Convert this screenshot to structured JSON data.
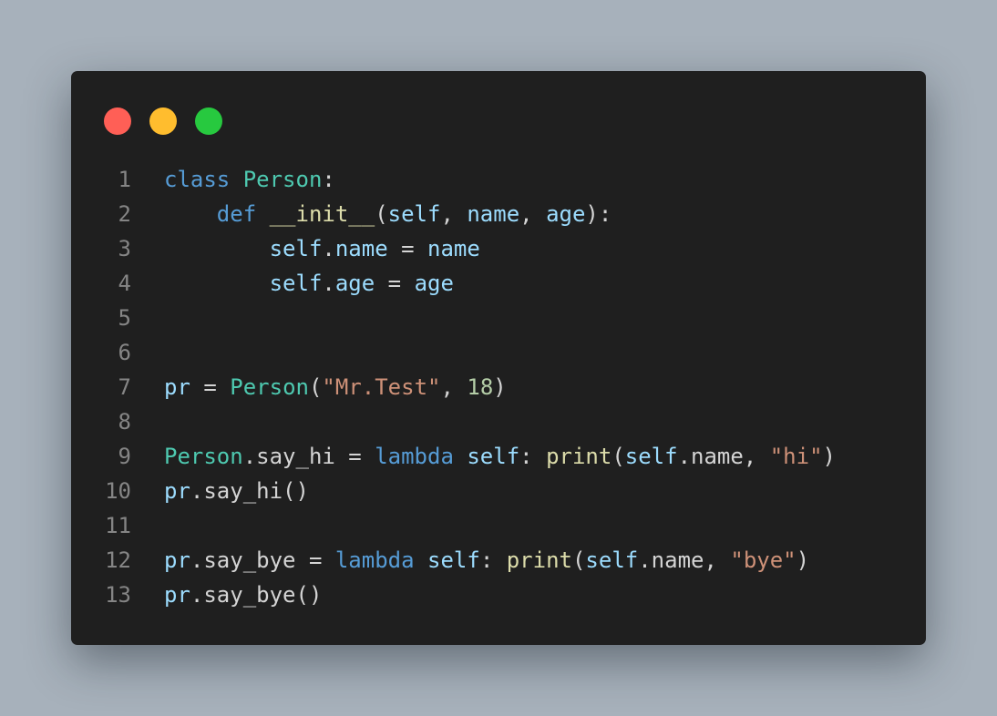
{
  "window": {
    "controls": [
      {
        "name": "close",
        "color": "#ff5f56"
      },
      {
        "name": "minimize",
        "color": "#ffbd2e"
      },
      {
        "name": "maximize",
        "color": "#27c93f"
      }
    ]
  },
  "code": {
    "language": "python",
    "lines": [
      {
        "n": "1",
        "tokens": [
          [
            "kw",
            "class"
          ],
          [
            "op",
            " "
          ],
          [
            "cls",
            "Person"
          ],
          [
            "op",
            ":"
          ]
        ]
      },
      {
        "n": "2",
        "tokens": [
          [
            "op",
            "    "
          ],
          [
            "kw",
            "def"
          ],
          [
            "op",
            " "
          ],
          [
            "fn",
            "__init__"
          ],
          [
            "op",
            "("
          ],
          [
            "var",
            "self"
          ],
          [
            "op",
            ", "
          ],
          [
            "var",
            "name"
          ],
          [
            "op",
            ", "
          ],
          [
            "var",
            "age"
          ],
          [
            "op",
            "):"
          ]
        ]
      },
      {
        "n": "3",
        "tokens": [
          [
            "op",
            "        "
          ],
          [
            "var",
            "self"
          ],
          [
            "op",
            "."
          ],
          [
            "var",
            "name"
          ],
          [
            "op",
            " = "
          ],
          [
            "var",
            "name"
          ]
        ]
      },
      {
        "n": "4",
        "tokens": [
          [
            "op",
            "        "
          ],
          [
            "var",
            "self"
          ],
          [
            "op",
            "."
          ],
          [
            "var",
            "age"
          ],
          [
            "op",
            " = "
          ],
          [
            "var",
            "age"
          ]
        ]
      },
      {
        "n": "5",
        "tokens": []
      },
      {
        "n": "6",
        "tokens": []
      },
      {
        "n": "7",
        "tokens": [
          [
            "var",
            "pr"
          ],
          [
            "op",
            " = "
          ],
          [
            "cls",
            "Person"
          ],
          [
            "op",
            "("
          ],
          [
            "str",
            "\"Mr.Test\""
          ],
          [
            "op",
            ", "
          ],
          [
            "num",
            "18"
          ],
          [
            "op",
            ")"
          ]
        ]
      },
      {
        "n": "8",
        "tokens": []
      },
      {
        "n": "9",
        "tokens": [
          [
            "cls",
            "Person"
          ],
          [
            "op",
            ".say_hi = "
          ],
          [
            "kw",
            "lambda"
          ],
          [
            "op",
            " "
          ],
          [
            "var",
            "self"
          ],
          [
            "op",
            ": "
          ],
          [
            "fn",
            "print"
          ],
          [
            "op",
            "("
          ],
          [
            "var",
            "self"
          ],
          [
            "op",
            ".name, "
          ],
          [
            "str",
            "\"hi\""
          ],
          [
            "op",
            ")"
          ]
        ]
      },
      {
        "n": "10",
        "tokens": [
          [
            "var",
            "pr"
          ],
          [
            "op",
            ".say_hi()"
          ]
        ]
      },
      {
        "n": "11",
        "tokens": []
      },
      {
        "n": "12",
        "tokens": [
          [
            "var",
            "pr"
          ],
          [
            "op",
            ".say_bye = "
          ],
          [
            "kw",
            "lambda"
          ],
          [
            "op",
            " "
          ],
          [
            "var",
            "self"
          ],
          [
            "op",
            ": "
          ],
          [
            "fn",
            "print"
          ],
          [
            "op",
            "("
          ],
          [
            "var",
            "self"
          ],
          [
            "op",
            ".name, "
          ],
          [
            "str",
            "\"bye\""
          ],
          [
            "op",
            ")"
          ]
        ]
      },
      {
        "n": "13",
        "tokens": [
          [
            "var",
            "pr"
          ],
          [
            "op",
            ".say_bye()"
          ]
        ]
      }
    ]
  }
}
